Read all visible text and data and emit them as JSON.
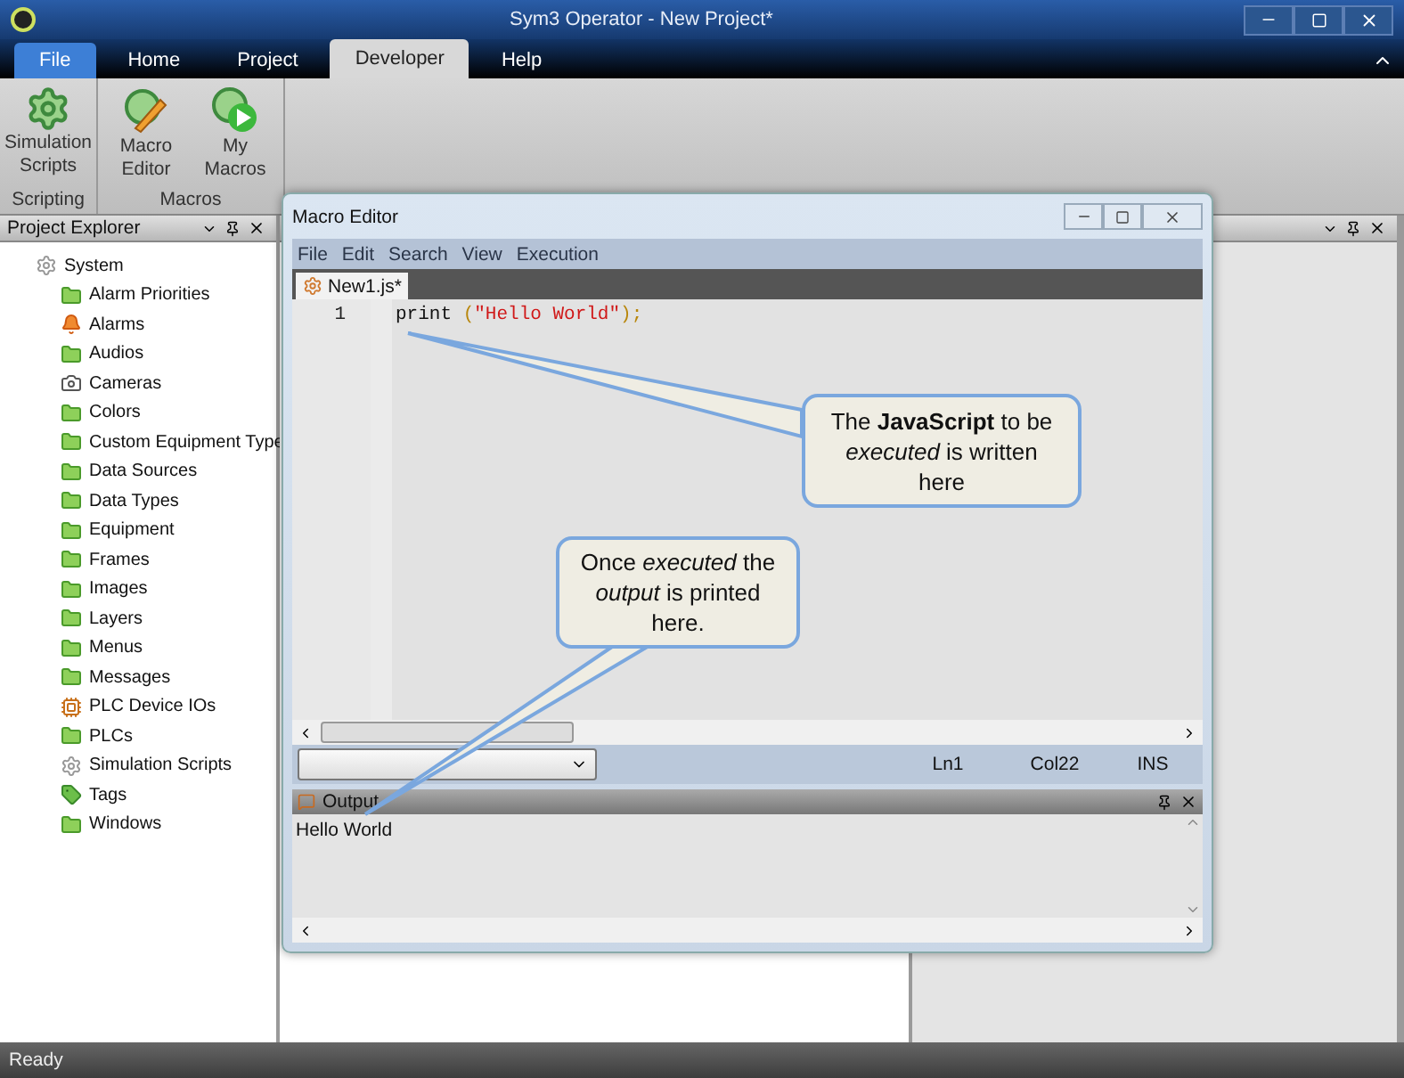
{
  "window": {
    "title": "Sym3 Operator - New Project*"
  },
  "tabs": [
    {
      "label": "File",
      "kind": "file",
      "selected": false
    },
    {
      "label": "Home",
      "kind": "tab",
      "selected": false
    },
    {
      "label": "Project",
      "kind": "tab",
      "selected": false
    },
    {
      "label": "Developer",
      "kind": "tab",
      "selected": true
    },
    {
      "label": "Help",
      "kind": "tab",
      "selected": false
    }
  ],
  "ribbon": {
    "groups": [
      {
        "label": "Scripting",
        "buttons": [
          {
            "label": "Simulation Scripts",
            "kind": "gear"
          }
        ]
      },
      {
        "label": "Macros",
        "buttons": [
          {
            "label": "Macro Editor",
            "kind": "edit"
          },
          {
            "label": "My Macros",
            "kind": "play"
          }
        ]
      }
    ]
  },
  "project_explorer": {
    "title": "Project Explorer",
    "tree": [
      {
        "label": "System",
        "kind": "gear",
        "children": [
          {
            "label": "Alarm Priorities",
            "kind": "folder"
          },
          {
            "label": "Alarms",
            "kind": "bell"
          },
          {
            "label": "Audios",
            "kind": "folder"
          },
          {
            "label": "Cameras",
            "kind": "camera"
          },
          {
            "label": "Colors",
            "kind": "folder"
          },
          {
            "label": "Custom Equipment Type",
            "kind": "folder"
          },
          {
            "label": "Data Sources",
            "kind": "folder"
          },
          {
            "label": "Data Types",
            "kind": "folder"
          },
          {
            "label": "Equipment",
            "kind": "folder"
          },
          {
            "label": "Frames",
            "kind": "folder"
          },
          {
            "label": "Images",
            "kind": "folder"
          },
          {
            "label": "Layers",
            "kind": "folder"
          },
          {
            "label": "Menus",
            "kind": "folder"
          },
          {
            "label": "Messages",
            "kind": "folder"
          },
          {
            "label": "PLC Device IOs",
            "kind": "plc"
          },
          {
            "label": "PLCs",
            "kind": "folder"
          },
          {
            "label": "Simulation Scripts",
            "kind": "gear"
          },
          {
            "label": "Tags",
            "kind": "tag"
          },
          {
            "label": "Windows",
            "kind": "folder"
          }
        ]
      }
    ]
  },
  "macro_editor": {
    "title": "Macro Editor",
    "menu": [
      "File",
      "Edit",
      "Search",
      "View",
      "Execution"
    ],
    "tab": {
      "label": "New1.js*",
      "selected": true
    },
    "lines": [
      {
        "number": "1",
        "tokens": [
          {
            "text": "print ",
            "kind": "plain"
          },
          {
            "text": "(",
            "kind": "punct"
          },
          {
            "text": "\"Hello World\"",
            "kind": "string"
          },
          {
            "text": ");",
            "kind": "punct"
          }
        ]
      }
    ],
    "status": {
      "line": "Ln1",
      "column": "Col22",
      "mode": "INS"
    },
    "output": {
      "title": "Output",
      "text": "Hello World"
    }
  },
  "callouts": [
    {
      "text": "The **JavaScript** to be *executed* is written here"
    },
    {
      "text": "Once *executed* the *output* is printed here."
    }
  ],
  "status_bar": {
    "text": "Ready"
  }
}
